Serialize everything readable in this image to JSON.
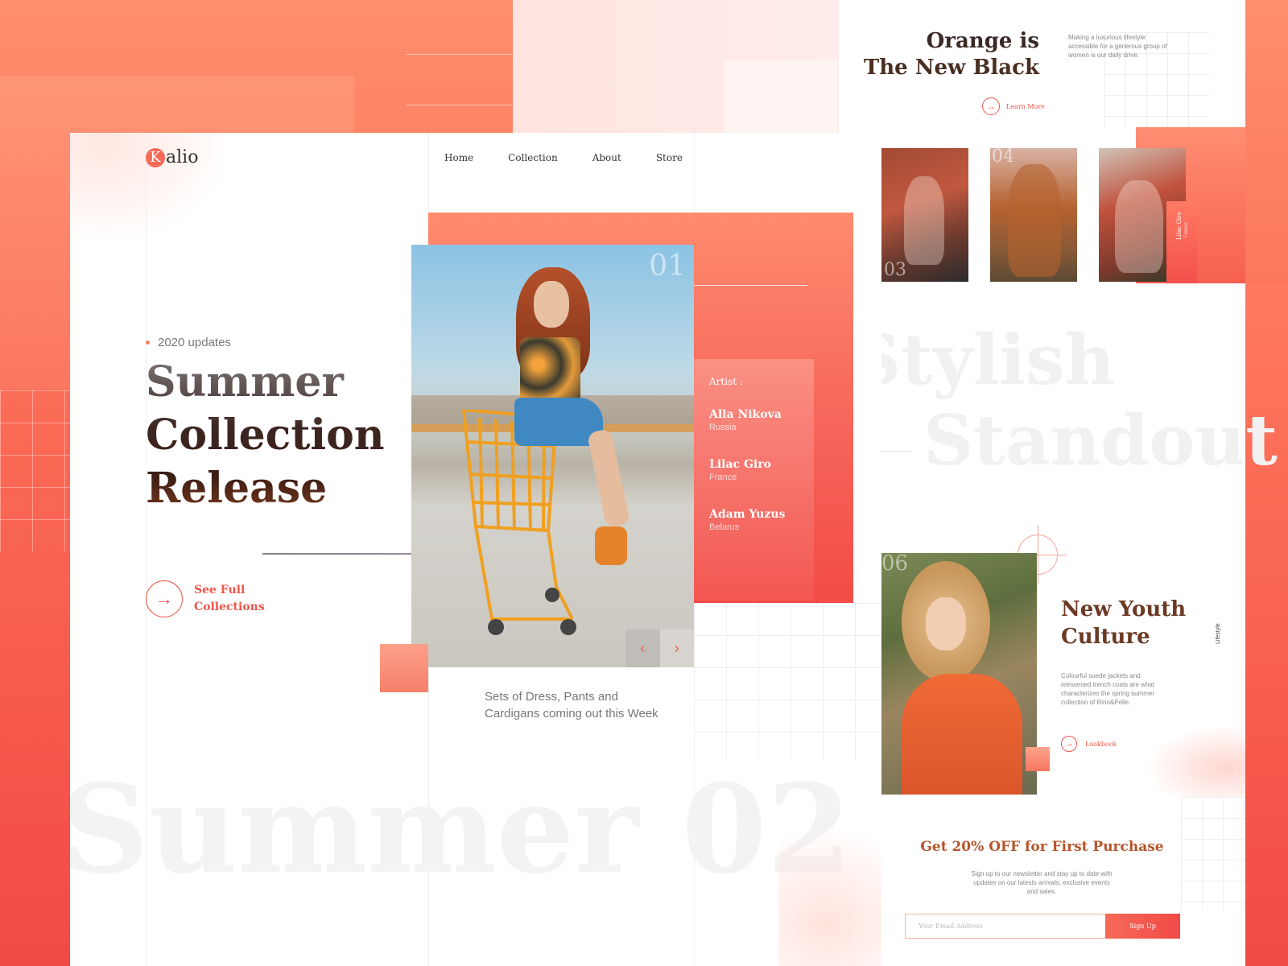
{
  "colors": {
    "accent": "#f0564a",
    "accent_light": "#ff8b6e",
    "heading_dark": "#3a1d14",
    "text_muted": "#777777"
  },
  "header": {
    "logo_letter": "K",
    "logo_rest": "alio",
    "nav": [
      "Home",
      "Collection",
      "About",
      "Store"
    ]
  },
  "hero": {
    "tag": "2020 updates",
    "title_lines": [
      "Summer",
      "Collection",
      "Release"
    ],
    "cta_line1": "See Full",
    "cta_line2": "Collections",
    "cta_icon": "arrow-right-icon",
    "slide_number": "01",
    "description": "Sets of Dress, Pants and Cardigans coming out this Week",
    "background_word": "Summer 02",
    "slider_prev_icon": "chevron-left-icon",
    "slider_next_icon": "chevron-right-icon"
  },
  "artists": {
    "heading": "Artist :",
    "items": [
      {
        "name": "Alla Nikova",
        "country": "Russia"
      },
      {
        "name": "Lilac Giro",
        "country": "France"
      },
      {
        "name": "Adam Yuzus",
        "country": "Belarus"
      }
    ]
  },
  "right_panel": {
    "title_line1": "Orange is",
    "title_line2": "The New Black",
    "description": "Making a luxurious lifestyle accessible for a generous group of women is our daily drive.",
    "learn_more": "Learn More",
    "thumb_numbers": [
      "03",
      "04"
    ],
    "thumb_label_name": "Lilac Giro",
    "thumb_label_country": "France",
    "background_words": [
      "Stylish",
      "Standout"
    ],
    "youth_number": "06",
    "youth_title_line1": "New Youth",
    "youth_title_line2": "Culture",
    "youth_description": "Colourful suede jackets and reinvented trench coats are what characterizes the spring summer collection of Rino&Pelle.",
    "lookbook": "Lookbook",
    "vertical_label": "Lifestyle",
    "offer_title": "Get 20% OFF for First Purchase",
    "offer_description": "Sign up to our newsletter and stay up to date with updates on our latests arrivals, exclusive events and sales.",
    "email_placeholder": "Your Email Address",
    "signup_button": "Sign Up"
  }
}
